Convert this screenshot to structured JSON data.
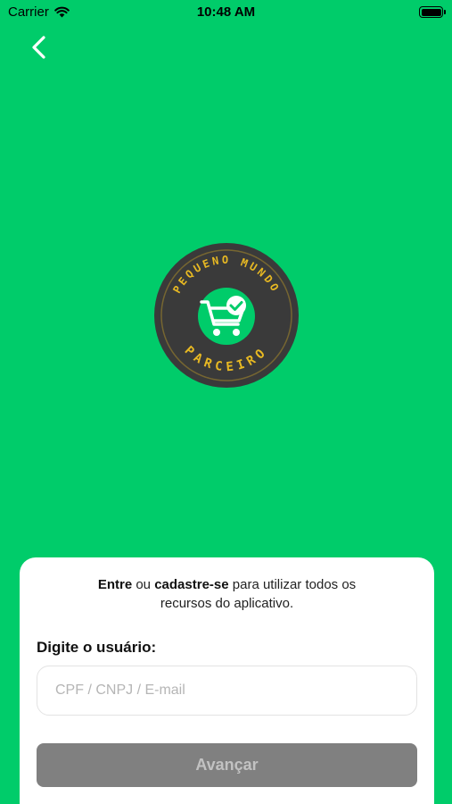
{
  "status_bar": {
    "carrier": "Carrier",
    "time": "10:48 AM",
    "wifi_icon": "wifi-icon",
    "battery_icon": "battery-icon"
  },
  "nav": {
    "back_icon": "chevron-left-icon"
  },
  "logo": {
    "top_text": "PEQUENO MUNDO",
    "bottom_text": "PARCEIRO",
    "icon": "shopping-cart-check-icon",
    "colors": {
      "ring": "#3A3A3A",
      "text": "#E8B923",
      "inner": "#00CC6A"
    }
  },
  "card": {
    "intro": {
      "part1": "Entre",
      "part2": " ou ",
      "part3": "cadastre-se",
      "part4": " para utilizar todos os",
      "part5": "recursos do aplicativo."
    },
    "field_label": "Digite o usuário:",
    "input": {
      "value": "",
      "placeholder": "CPF / CNPJ / E-mail"
    },
    "submit_label": "Avançar"
  },
  "colors": {
    "background": "#00CC6A",
    "card": "#FFFFFF",
    "button_disabled": "#808080",
    "button_text_disabled": "#C2C2C2"
  }
}
